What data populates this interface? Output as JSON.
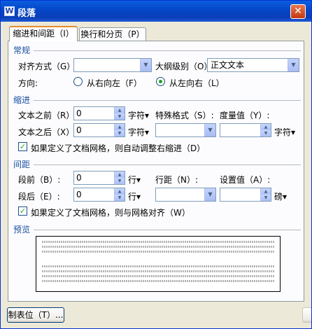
{
  "title": "段落",
  "app_icon_glyph": "W",
  "close_glyph": "✕",
  "tabs": [
    {
      "label": "缩进和间距（I）"
    },
    {
      "label": "换行和分页（P）"
    }
  ],
  "general": {
    "section": "常规",
    "align_label": "对齐方式（G）:",
    "align_value": "",
    "outline_label": "大纲级别（O）:",
    "outline_value": "正文文本",
    "direction_label": "方向:",
    "rtl_label": "从右向左（F）",
    "ltr_label": "从左向右（L）",
    "selected_direction": "ltr"
  },
  "indent": {
    "section": "缩进",
    "before_label": "文本之前（R）:",
    "before_value": "0",
    "before_unit": "字符▾",
    "special_label": "特殊格式（S）:",
    "special_value": "",
    "measure_label": "度量值（Y）:",
    "measure_value": "",
    "measure_unit": "字符▾",
    "after_label": "文本之后（X）:",
    "after_value": "0",
    "after_unit": "字符▾",
    "auto_adjust_label": "如果定义了文档网格，则自动调整右缩进（D）",
    "auto_adjust_checked": true
  },
  "spacing": {
    "section": "间距",
    "before_label": "段前（B）:",
    "before_value": "0",
    "before_unit": "行▾",
    "line_label": "行距（N）:",
    "line_value": "",
    "setting_label": "设置值（A）:",
    "setting_value": "",
    "setting_unit": "磅▾",
    "after_label": "段后（E）:",
    "after_value": "0",
    "after_unit": "行▾",
    "snap_label": "如果定义了文档网格，则与网格对齐（W）",
    "snap_checked": true
  },
  "preview": {
    "section": "预览"
  },
  "buttons": {
    "tabs_label": "制表位（T）..."
  }
}
